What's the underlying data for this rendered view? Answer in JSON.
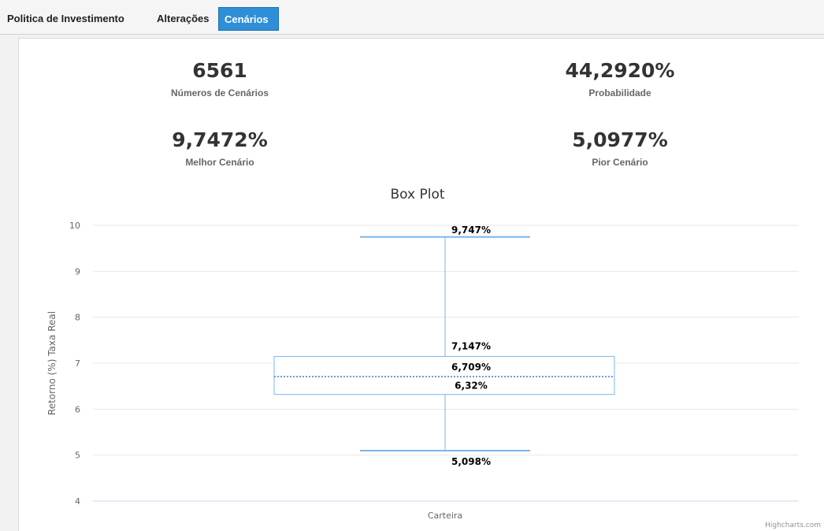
{
  "tabs": [
    {
      "label": "Politica de Investimento"
    },
    {
      "label": "Alterações"
    },
    {
      "label": "Cenários"
    }
  ],
  "stats": {
    "scenarios": {
      "value": "6561",
      "label": "Números de Cenários"
    },
    "probability": {
      "value": "44,2920%",
      "label": "Probabilidade"
    },
    "best": {
      "value": "9,7472%",
      "label": "Melhor Cenário"
    },
    "worst": {
      "value": "5,0977%",
      "label": "Pior Cenário"
    }
  },
  "chart_data": {
    "type": "boxplot",
    "title": "Box Plot",
    "xlabel": "",
    "ylabel": "Retorno (%) Taxa Real",
    "categories": [
      "Carteira"
    ],
    "ylim": [
      4,
      10
    ],
    "yticks": [
      4,
      5,
      6,
      7,
      8,
      9,
      10
    ],
    "grid": true,
    "series": [
      {
        "values": [
          {
            "low": 5.098,
            "q1": 6.32,
            "median": 6.709,
            "q3": 7.147,
            "high": 9.747
          }
        ]
      }
    ],
    "data_labels": [
      "9,747%",
      "7,147%",
      "6,709%",
      "6,32%",
      "5,098%"
    ],
    "credits": "Highcharts.com",
    "colors": {
      "series": "#7cb5ec",
      "grid": "#e6e6e6",
      "axis_text": "#666666",
      "title": "#333333"
    }
  }
}
